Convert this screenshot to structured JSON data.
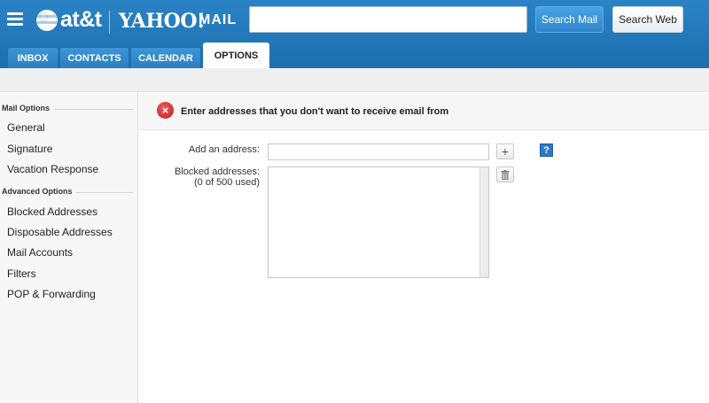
{
  "header": {
    "att_logo_text": "at&t",
    "yahoo_logo_text": "YAHOO!",
    "mail_logo_text": "MAIL",
    "search": {
      "value": "",
      "placeholder": ""
    },
    "search_mail_label": "Search Mail",
    "search_web_label": "Search Web"
  },
  "tabs": [
    {
      "label": "INBOX"
    },
    {
      "label": "CONTACTS"
    },
    {
      "label": "CALENDAR"
    },
    {
      "label": "OPTIONS",
      "active": true
    }
  ],
  "sidebar": {
    "mail_options_heading": "Mail Options",
    "mail_options": [
      {
        "label": "General"
      },
      {
        "label": "Signature"
      },
      {
        "label": "Vacation Response"
      }
    ],
    "advanced_options_heading": "Advanced Options",
    "advanced_options": [
      {
        "label": "Blocked Addresses"
      },
      {
        "label": "Disposable Addresses"
      },
      {
        "label": "Mail Accounts"
      },
      {
        "label": "Filters"
      },
      {
        "label": "POP & Forwarding"
      }
    ]
  },
  "main": {
    "notice": "Enter addresses that you don't want to receive email from",
    "add_address_label": "Add an address:",
    "add_address_value": "",
    "blocked_label": "Blocked addresses:",
    "blocked_count": "(0 of 500 used)",
    "blocked_addresses": [],
    "add_button": "+",
    "help_icon": "?",
    "error_icon": "×"
  },
  "colors": {
    "header_blue": "#1d6fae",
    "accent_blue": "#2f86cc",
    "error_red": "#c21f1f"
  }
}
